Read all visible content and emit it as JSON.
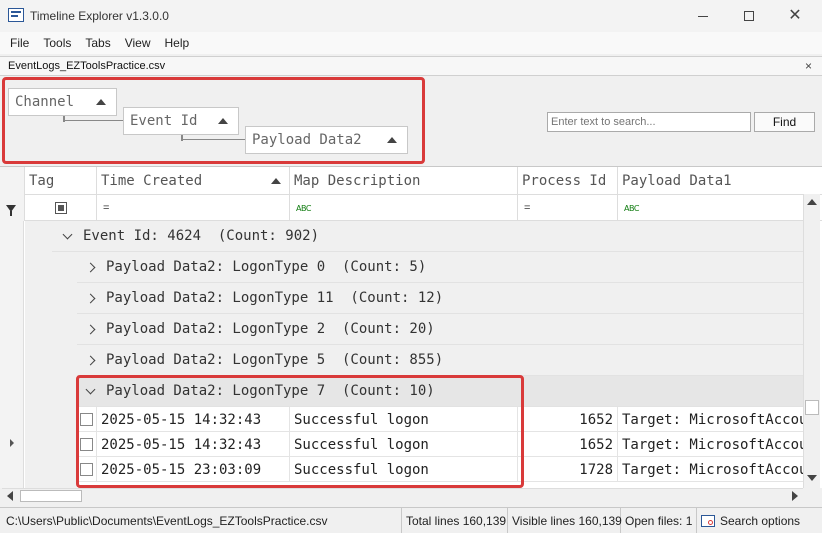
{
  "window": {
    "title": "Timeline Explorer v1.3.0.0"
  },
  "menu": [
    "File",
    "Tools",
    "Tabs",
    "View",
    "Help"
  ],
  "tab": {
    "label": "EventLogs_EZToolsPractice.csv",
    "close": "×"
  },
  "group_panel": {
    "chips": [
      "Channel",
      "Event Id",
      "Payload Data2"
    ],
    "search_placeholder": "Enter text to search...",
    "find_label": "Find"
  },
  "grid": {
    "columns": [
      "Tag",
      "Time Created",
      "Map Description",
      "Process Id",
      "Payload Data1"
    ],
    "filters": {
      "equals": "=",
      "contains": "ABC"
    },
    "groups": [
      {
        "text": "Event Id: 4624  (Count: 902)",
        "expanded": true,
        "level": 1
      },
      {
        "text": "Payload Data2: LogonType 0  (Count: 5)",
        "expanded": false,
        "level": 2
      },
      {
        "text": "Payload Data2: LogonType 11  (Count: 12)",
        "expanded": false,
        "level": 2
      },
      {
        "text": "Payload Data2: LogonType 2  (Count: 20)",
        "expanded": false,
        "level": 2
      },
      {
        "text": "Payload Data2: LogonType 5  (Count: 855)",
        "expanded": false,
        "level": 2
      },
      {
        "text": "Payload Data2: LogonType 7  (Count: 10)",
        "expanded": true,
        "level": 2
      }
    ],
    "rows": [
      {
        "time": "2025-05-15 14:32:43",
        "desc": "Successful logon",
        "pid": "1652",
        "payload1": "Target: MicrosoftAccount\\"
      },
      {
        "time": "2025-05-15 14:32:43",
        "desc": "Successful logon",
        "pid": "1652",
        "payload1": "Target: MicrosoftAccount\\"
      },
      {
        "time": "2025-05-15 23:03:09",
        "desc": "Successful logon",
        "pid": "1728",
        "payload1": "Target: MicrosoftAccount\\"
      }
    ]
  },
  "status": {
    "path": "C:\\Users\\Public\\Documents\\EventLogs_EZToolsPractice.csv",
    "total": "Total lines 160,139",
    "visible": "Visible lines 160,139",
    "open_files": "Open files: 1",
    "search_options": "Search options"
  },
  "colors": {
    "highlight_box": "#d93a3a",
    "accent": "#2b5797"
  }
}
